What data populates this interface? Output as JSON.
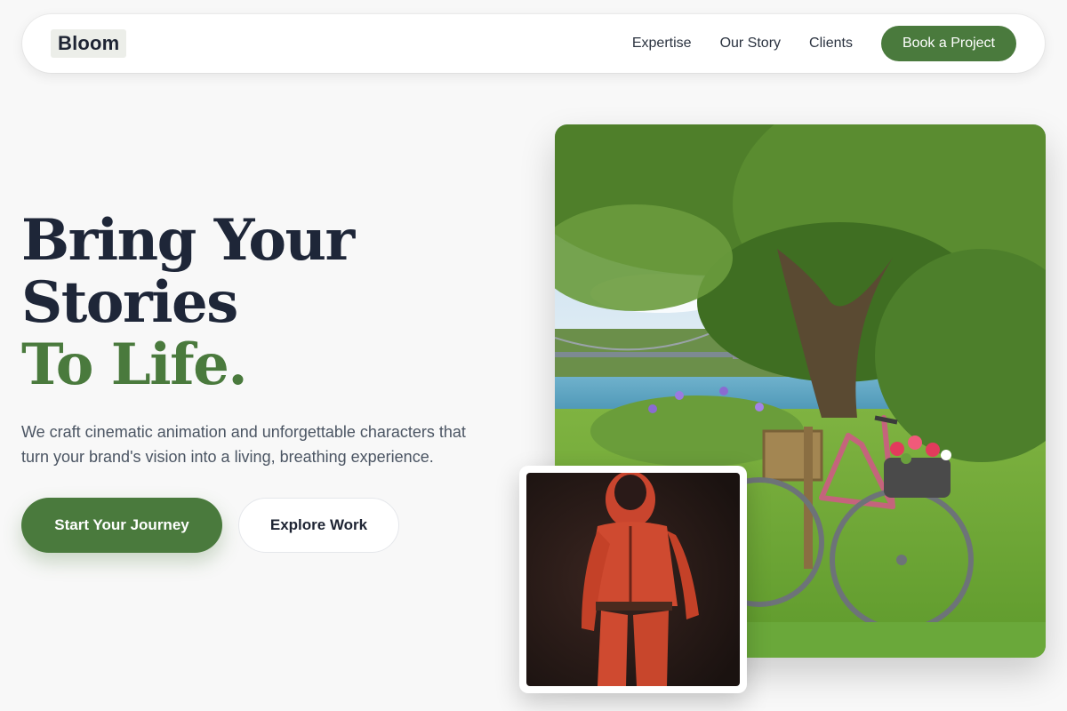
{
  "nav": {
    "logo": "Bloom",
    "links": [
      "Expertise",
      "Our Story",
      "Clients"
    ],
    "cta": "Book a Project"
  },
  "hero": {
    "headline_line1": "Bring Your",
    "headline_line2": "Stories",
    "headline_line3": "To Life.",
    "subtitle": "We craft cinematic animation and unforgettable characters that turn your brand's vision into a living, breathing experience.",
    "primary_button": "Start Your Journey",
    "secondary_button": "Explore Work"
  },
  "images": {
    "main": "bicycle-by-river-photo",
    "inset": "red-suit-character-render"
  },
  "colors": {
    "accent": "#4a7a3d",
    "heading": "#1e2638",
    "background": "#f8f8f8"
  }
}
